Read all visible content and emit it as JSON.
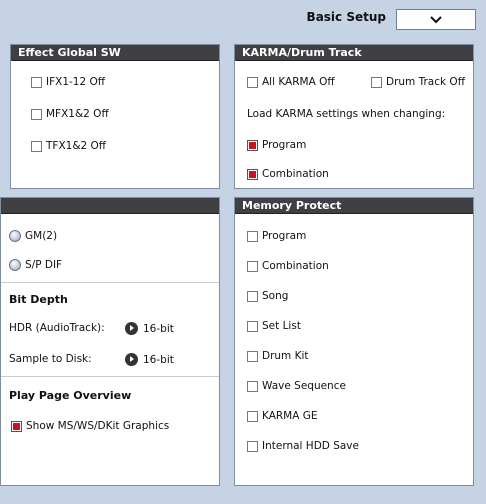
{
  "header": {
    "title": "Basic Setup"
  },
  "effect_global": {
    "title": "Effect Global SW",
    "items": [
      {
        "label": "IFX1-12 Off",
        "checked": false
      },
      {
        "label": "MFX1&2 Off",
        "checked": false
      },
      {
        "label": "TFX1&2 Off",
        "checked": false
      }
    ]
  },
  "karma_drum": {
    "title": "KARMA/Drum Track",
    "all_karma_off": "All KARMA Off",
    "drum_track_off": "Drum Track Off",
    "load_label": "Load KARMA settings when changing:",
    "program": "Program",
    "combination": "Combination"
  },
  "audio": {
    "gm2": "GM(2)",
    "spdif": "S/P DIF",
    "bit_depth_title": "Bit Depth",
    "hdr_label": "HDR (AudioTrack):",
    "hdr_value": "16-bit",
    "sample_label": "Sample to Disk:",
    "sample_value": "16-bit",
    "play_page_title": "Play Page Overview",
    "show_graphics": "Show MS/WS/DKit Graphics"
  },
  "memory_protect": {
    "title": "Memory Protect",
    "items": [
      "Program",
      "Combination",
      "Song",
      "Set List",
      "Drum Kit",
      "Wave Sequence",
      "KARMA GE",
      "Internal HDD Save"
    ]
  }
}
